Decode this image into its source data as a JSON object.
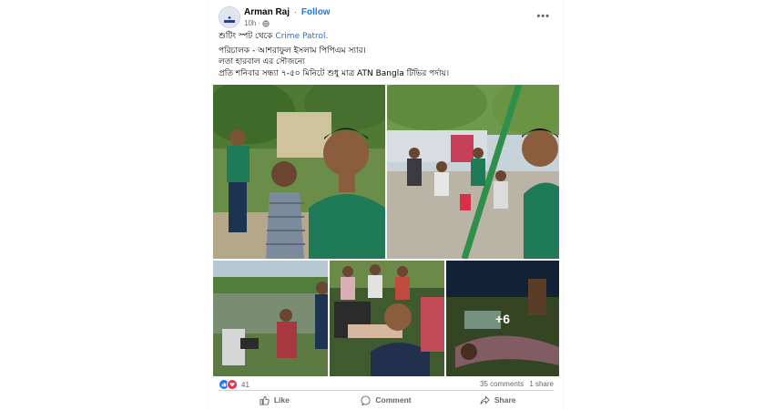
{
  "post": {
    "author": "Arman Raj",
    "separator": "·",
    "follow_label": "Follow",
    "time": "10h",
    "privacy_icon": "globe-icon",
    "menu_icon": "more-dots-icon"
  },
  "text": {
    "line1_prefix": "শুটিং স্পট থেকে ",
    "line1_link": "Crime Patrol.",
    "line2": "পরিচালক - আশরাফুল ইসলাম পিপিএম স্যার।",
    "line3": "লতা হারবাল এর সৌজন্যে",
    "line4": "প্রতি শনিবার সন্ধ্যা ৭-৫০ মিনিটে শুধু মাত্র ATN Bangla টিভির পর্দায়।"
  },
  "photos": {
    "more_count": "+6"
  },
  "stats": {
    "reaction_count": "41",
    "comments": "35 comments",
    "shares": "1 share"
  },
  "actions": {
    "like": "Like",
    "comment": "Comment",
    "share": "Share"
  },
  "colors": {
    "link": "#216fdb",
    "follow": "#1877f2",
    "uniform_green": "#1f7a58"
  }
}
